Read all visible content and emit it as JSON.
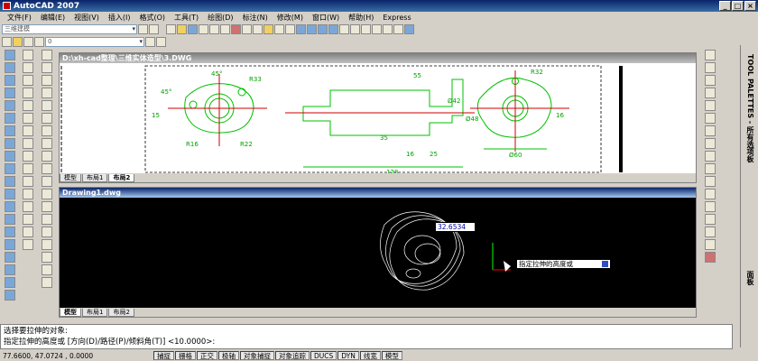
{
  "title": "AutoCAD 2007",
  "menu": [
    "文件(F)",
    "编辑(E)",
    "视图(V)",
    "插入(I)",
    "格式(O)",
    "工具(T)",
    "绘图(D)",
    "标注(N)",
    "修改(M)",
    "窗口(W)",
    "帮助(H)",
    "Express"
  ],
  "workspace": "三维建模",
  "layer_value": "0",
  "window1": {
    "title": "D:\\xh-cad整理\\三维实体造型\\3.DWG",
    "tabs": [
      "模型",
      "布局1",
      "布局2"
    ],
    "dims": {
      "a45": "45°",
      "r33": "R33",
      "r16": "R16",
      "r22": "R22",
      "a45b": "45°",
      "d15": "15",
      "r32": "R32",
      "d60": "Ø60",
      "d25": "25",
      "d128": "128",
      "d35": "35",
      "d16": "16",
      "d55": "55",
      "d42": "Ø42",
      "d48": "Ø48",
      "d16b": "16"
    }
  },
  "window2": {
    "title": "Drawing1.dwg",
    "tabs": [
      "模型",
      "布局1",
      "布局2"
    ],
    "input_value": "32.6534",
    "tooltip": "指定拉伸的高度或"
  },
  "command": {
    "line1": "选择要拉伸的对象:",
    "line2": "指定拉伸的高度或 [方向(D)/路径(P)/倾斜角(T)] <10.0000>:"
  },
  "status": {
    "coords": "77.6600,  47.0724 , 0.0000",
    "buttons": [
      "捕捉",
      "栅格",
      "正交",
      "极轴",
      "对象捕捉",
      "对象追踪",
      "DUCS",
      "DYN",
      "线宽",
      "模型"
    ]
  },
  "palettes": {
    "tool": "TOOL PALETTES - 所有选项板",
    "panel": "面板"
  }
}
